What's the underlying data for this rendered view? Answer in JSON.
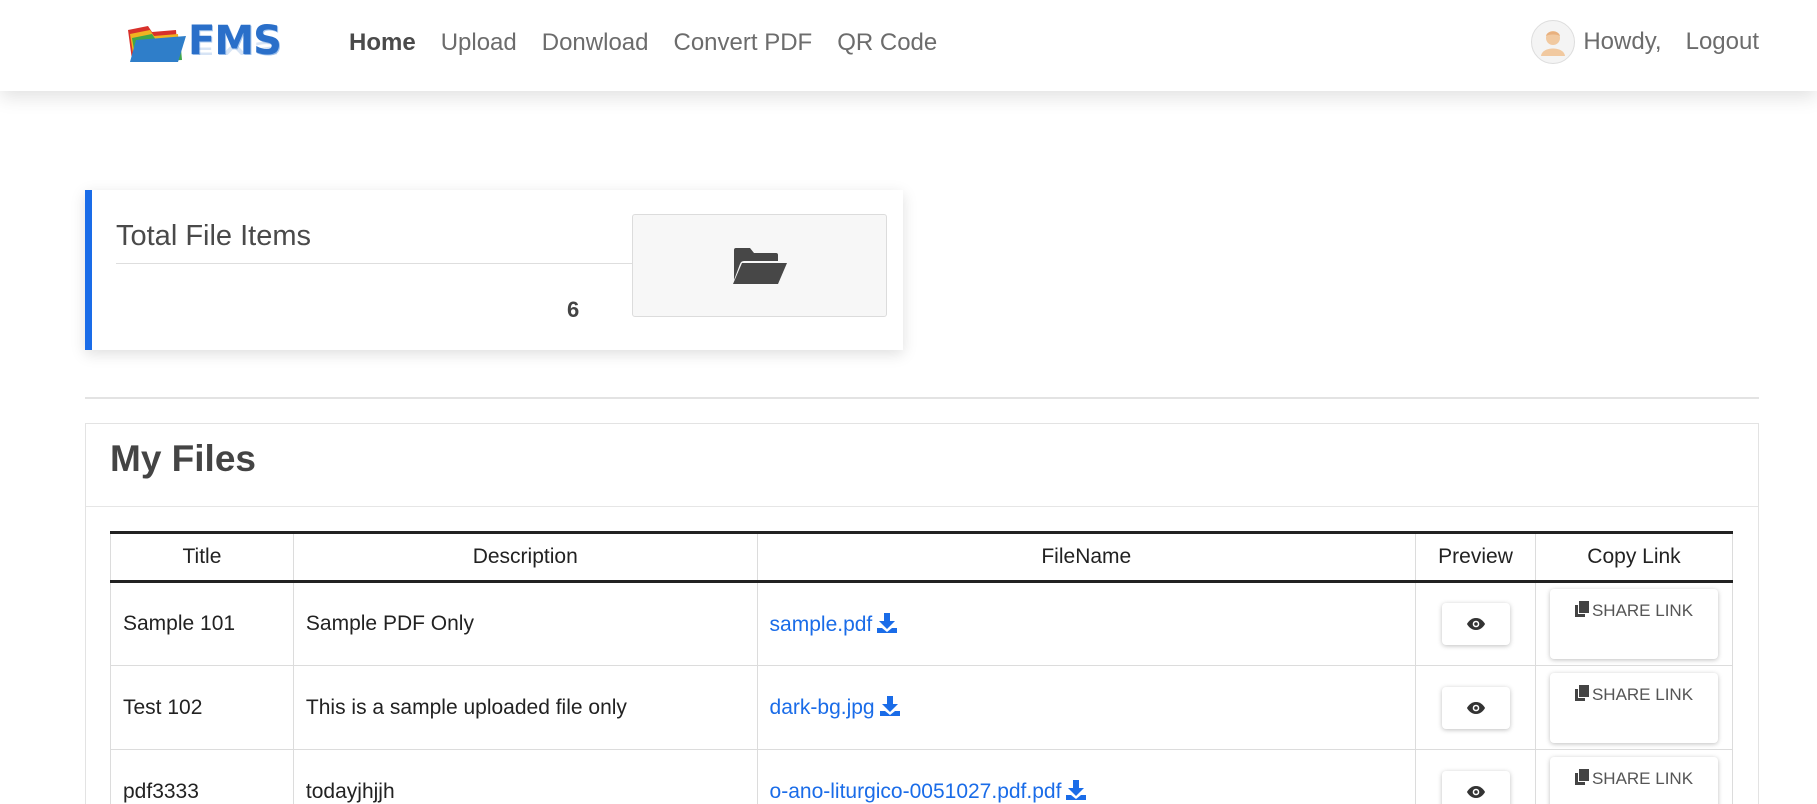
{
  "brand": {
    "logo_text": "FMS"
  },
  "nav": {
    "items": [
      {
        "label": "Home",
        "active": true
      },
      {
        "label": "Upload",
        "active": false
      },
      {
        "label": "Donwload",
        "active": false
      },
      {
        "label": "Convert PDF",
        "active": false
      },
      {
        "label": "QR Code",
        "active": false
      }
    ],
    "greeting": "Howdy,",
    "logout_label": "Logout"
  },
  "stats": {
    "title": "Total File Items",
    "value": "6",
    "icon": "folder-open-icon"
  },
  "files": {
    "title": "My Files",
    "columns": [
      "Title",
      "Description",
      "FileName",
      "Preview",
      "Copy Link"
    ],
    "share_label": "SHARE LINK",
    "rows": [
      {
        "title": "Sample 101",
        "description": "Sample PDF Only",
        "filename": "sample.pdf"
      },
      {
        "title": "Test 102",
        "description": "This is a sample uploaded file only",
        "filename": "dark-bg.jpg"
      },
      {
        "title": "pdf3333",
        "description": "todayjhjjh",
        "filename": "o-ano-liturgico-0051027.pdf.pdf"
      }
    ]
  },
  "colors": {
    "accent": "#1a6ce8",
    "text": "#222222",
    "muted": "#6c6c6c"
  }
}
